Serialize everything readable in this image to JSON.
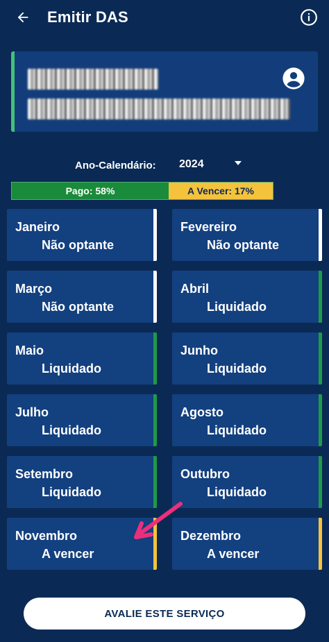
{
  "header": {
    "title": "Emitir DAS",
    "back_icon": "arrow-left-icon",
    "info_icon": "info-icon"
  },
  "profile": {
    "avatar_icon": "account-circle-icon"
  },
  "year": {
    "label": "Ano-Calendário:",
    "value": "2024"
  },
  "progress": {
    "paid_label": "Pago: 58%",
    "paid_fraction": 0.58,
    "due_label": "A Vencer: 17%",
    "due_fraction": 0.17,
    "paid_color": "#1a8b3a",
    "due_color": "#f5c23c"
  },
  "months": [
    {
      "name": "Janeiro",
      "status": "Não optante"
    },
    {
      "name": "Fevereiro",
      "status": "Não optante"
    },
    {
      "name": "Março",
      "status": "Não optante"
    },
    {
      "name": "Abril",
      "status": "Liquidado"
    },
    {
      "name": "Maio",
      "status": "Liquidado"
    },
    {
      "name": "Junho",
      "status": "Liquidado"
    },
    {
      "name": "Julho",
      "status": "Liquidado"
    },
    {
      "name": "Agosto",
      "status": "Liquidado"
    },
    {
      "name": "Setembro",
      "status": "Liquidado"
    },
    {
      "name": "Outubro",
      "status": "Liquidado"
    },
    {
      "name": "Novembro",
      "status": "A vencer"
    },
    {
      "name": "Dezembro",
      "status": "A vencer"
    }
  ],
  "footer": {
    "rate_label": "AVALIE ESTE SERVIÇO"
  }
}
